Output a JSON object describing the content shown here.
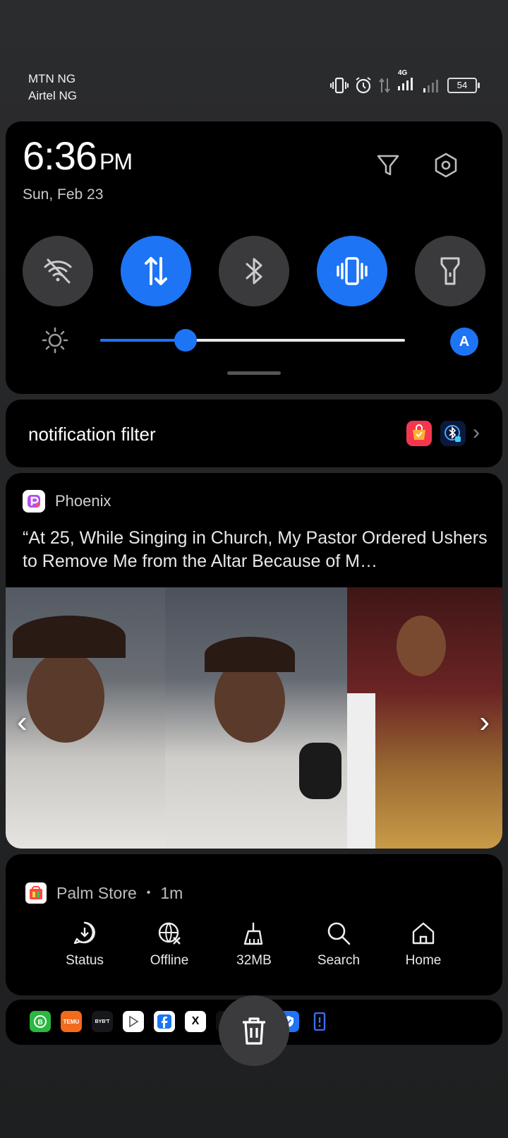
{
  "status_bar": {
    "carrier_1": "MTN NG",
    "carrier_2": "Airtel NG",
    "network_type": "4G",
    "battery": "54",
    "icons": [
      "vibrate-icon",
      "alarm-icon",
      "data-arrows-icon",
      "signal-icon",
      "signal-icon-2"
    ]
  },
  "quick_settings": {
    "time": "6:36",
    "ampm": "PM",
    "date": "Sun, Feb 23",
    "top_icons": [
      "filter-icon",
      "settings-icon"
    ],
    "tiles": [
      {
        "name": "wifi",
        "icon": "wifi-off-icon",
        "active": false
      },
      {
        "name": "mobile-data",
        "icon": "data-arrows-icon",
        "active": true
      },
      {
        "name": "bluetooth",
        "icon": "bluetooth-icon",
        "active": false
      },
      {
        "name": "vibrate",
        "icon": "vibrate-icon",
        "active": true
      },
      {
        "name": "flashlight",
        "icon": "flashlight-icon",
        "active": false
      }
    ],
    "brightness_level": 0.28,
    "auto_brightness_label": "A",
    "accent_color": "#1d74f5"
  },
  "notification_filter": {
    "label": "notification filter",
    "apps": [
      "temu-shop-icon",
      "bluetooth-badge-icon"
    ]
  },
  "phoenix": {
    "app_name": "Phoenix",
    "title": "“At 25, While Singing in Church, My Pastor Ordered Ushers to Remove Me from the Altar Because of M…",
    "prev": "‹",
    "next": "›"
  },
  "palm_store": {
    "app_name": "Palm Store",
    "separator": "•",
    "time": "1m",
    "actions": [
      {
        "label": "Status",
        "icon": "download-chat-icon"
      },
      {
        "label": "Offline",
        "icon": "globe-off-icon"
      },
      {
        "label": "32MB",
        "icon": "broom-icon"
      },
      {
        "label": "Search",
        "icon": "search-icon"
      },
      {
        "label": "Home",
        "icon": "home-icon"
      }
    ]
  },
  "tray": {
    "bybit_label": "BYB'T",
    "temu_label": "TEMU",
    "x_label": "X"
  }
}
